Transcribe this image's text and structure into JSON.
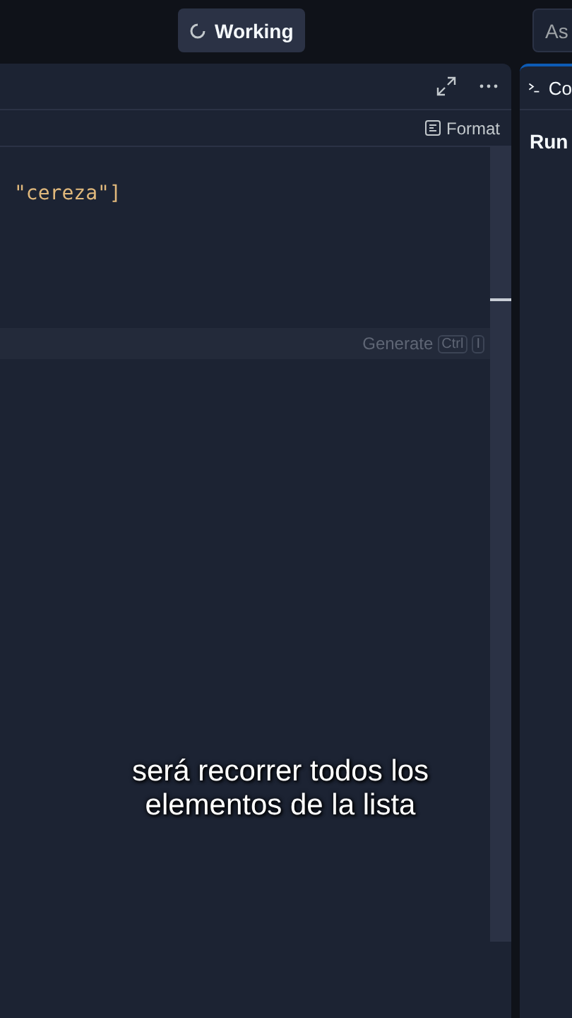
{
  "top_bar": {
    "status_button": {
      "label": "Working"
    },
    "ask_field": {
      "placeholder": "As"
    }
  },
  "editor": {
    "format_button": {
      "label": "Format"
    },
    "code_lines": [
      "\"cereza\"]"
    ],
    "generate_hint": {
      "label": "Generate",
      "keys": [
        "Ctrl",
        "I"
      ]
    },
    "subtitle_lines": [
      "será recorrer todos los",
      "elementos de la lista"
    ]
  },
  "side_panel": {
    "title": "Co",
    "text": "Run"
  }
}
